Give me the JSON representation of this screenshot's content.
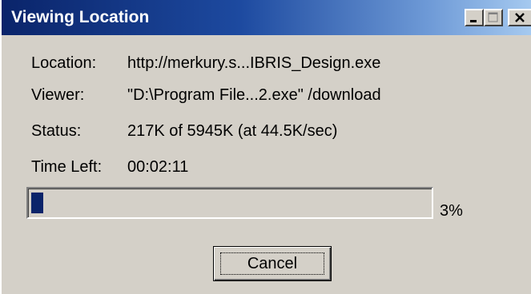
{
  "window": {
    "title": "Viewing Location",
    "controls": {
      "minimize": "minimize",
      "maximize": "maximize",
      "close": "close"
    }
  },
  "fields": {
    "location": {
      "label": "Location:",
      "value": "http://merkury.s...IBRIS_Design.exe"
    },
    "viewer": {
      "label": "Viewer:",
      "value": "\"D:\\Program File...2.exe\" /download"
    },
    "status": {
      "label": "Status:",
      "value": "217K of 5945K (at 44.5K/sec)"
    },
    "time_left": {
      "label": "Time Left:",
      "value": "00:02:11"
    }
  },
  "progress": {
    "percent": 3,
    "percent_text": "3%"
  },
  "cancel_label": "Cancel",
  "colors": {
    "face": "#d4d0c8",
    "title_start": "#0a246a",
    "title_end": "#a6caf0",
    "progress_fill": "#0a246a"
  }
}
